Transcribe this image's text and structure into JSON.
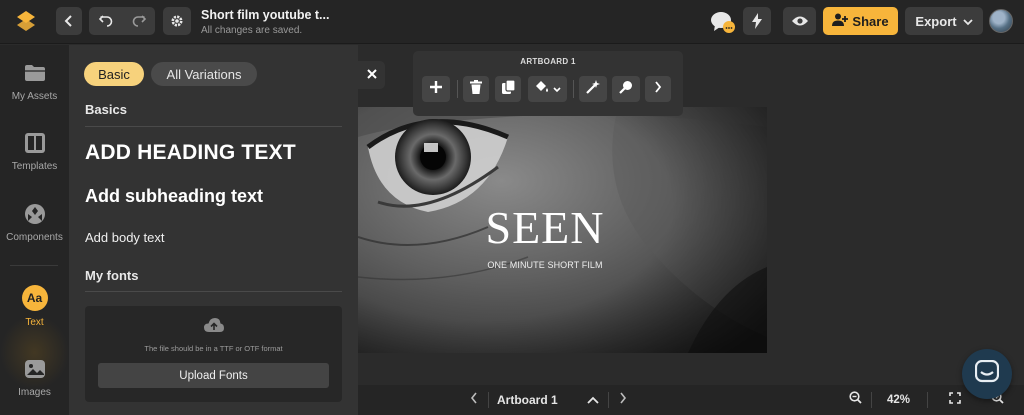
{
  "colors": {
    "accent": "#f7b53b",
    "tab_active": "#f7d27c",
    "panel": "#333333",
    "topbar": "#252525",
    "chat": "#1f3a4f"
  },
  "topbar": {
    "doc_title": "Short film youtube t...",
    "doc_status": "All changes are saved.",
    "share_label": "Share",
    "export_label": "Export",
    "icons": [
      "logo-icon",
      "back-icon",
      "undo-icon",
      "redo-icon",
      "gear-icon",
      "comments-icon",
      "lightning-icon",
      "eye-icon",
      "add-user-icon",
      "chevron-down-icon"
    ]
  },
  "rail": {
    "items": [
      {
        "label": "My Assets",
        "icon": "folder-icon"
      },
      {
        "label": "Templates",
        "icon": "templates-icon"
      },
      {
        "label": "Components",
        "icon": "components-icon"
      },
      {
        "label": "Text",
        "icon": "text-icon",
        "badge": "Aa",
        "active": true
      },
      {
        "label": "Images",
        "icon": "images-icon"
      }
    ]
  },
  "panel": {
    "tabs": [
      {
        "label": "Basic",
        "active": true
      },
      {
        "label": "All Variations",
        "active": false
      }
    ],
    "basics_title": "Basics",
    "heading_text": "ADD HEADING TEXT",
    "subheading_text": "Add subheading text",
    "body_text": "Add body text",
    "my_fonts_title": "My fonts",
    "upload_note": "The file should be in a TTF or OTF format",
    "upload_button": "Upload Fonts"
  },
  "artboard_toolbar": {
    "title": "ARTBOARD 1",
    "icons": [
      "add-icon",
      "trash-icon",
      "duplicate-icon",
      "fill-icon",
      "chevron-down-icon",
      "magic-wand-icon",
      "remove-background-icon",
      "chevron-right-icon"
    ]
  },
  "artboard": {
    "title": "SEEN",
    "subtitle": "ONE MINUTE SHORT FILM"
  },
  "bottombar": {
    "artboard_name": "Artboard 1",
    "zoom": "42%"
  }
}
